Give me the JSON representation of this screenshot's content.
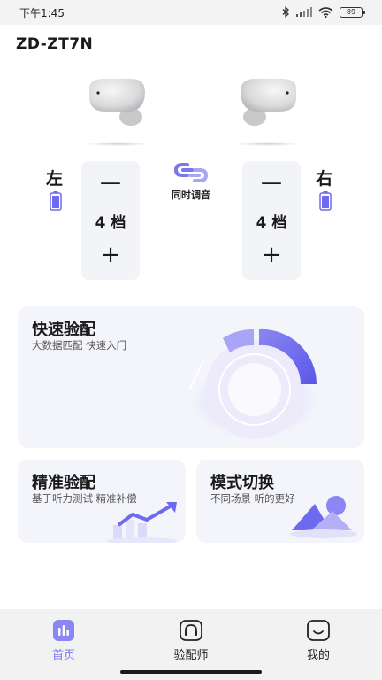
{
  "status_bar": {
    "time": "下午1:45",
    "battery_level": "89"
  },
  "device": {
    "name": "ZD-ZT7N"
  },
  "left": {
    "label": "左",
    "minus": "—",
    "level": "4 档",
    "plus": "+"
  },
  "right": {
    "label": "右",
    "minus": "—",
    "level": "4 档",
    "plus": "+"
  },
  "sync": {
    "label": "同时调音"
  },
  "cards": {
    "quick_fit": {
      "title": "快速验配",
      "subtitle": "大数据匹配 快速入门"
    },
    "precise_fit": {
      "title": "精准验配",
      "subtitle": "基于听力测试 精准补偿"
    },
    "mode_switch": {
      "title": "模式切换",
      "subtitle": "不同场景 听的更好"
    }
  },
  "nav": {
    "home": "首页",
    "fitter": "验配师",
    "mine": "我的"
  },
  "colors": {
    "accent": "#6e6af0",
    "accent_light": "#a9a5f6",
    "card_bg": "#f4f5fb",
    "level_card_bg": "#f3f4f8",
    "nav_bg": "#f2f2f3"
  }
}
